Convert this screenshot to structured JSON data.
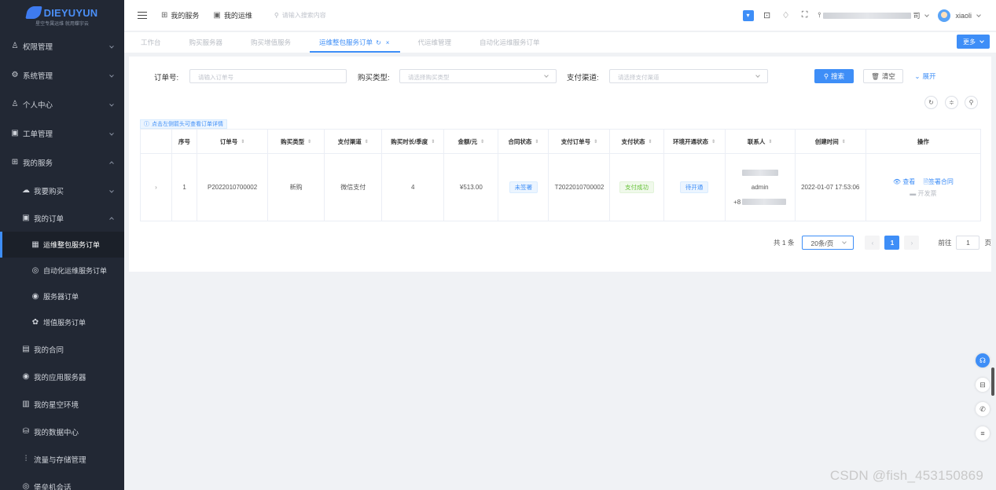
{
  "sidebar": {
    "brand": "DIEYUYUN",
    "brand_sub": "星空专属运维 就用蝶宇云",
    "items": [
      {
        "label": "权限管理",
        "level": 1,
        "icon": "user-icon",
        "glyph": "♙",
        "expanded": false
      },
      {
        "label": "系统管理",
        "level": 1,
        "icon": "settings-icon",
        "glyph": "⚙",
        "expanded": false
      },
      {
        "label": "个人中心",
        "level": 1,
        "icon": "user-icon",
        "glyph": "♙",
        "expanded": false
      },
      {
        "label": "工单管理",
        "level": 1,
        "icon": "ticket-icon",
        "glyph": "▣",
        "expanded": false
      },
      {
        "label": "我的服务",
        "level": 1,
        "icon": "grid-icon",
        "glyph": "⊞",
        "expanded": true
      },
      {
        "label": "我要购买",
        "level": 2,
        "icon": "cloud-icon",
        "glyph": "☁",
        "expanded": false
      },
      {
        "label": "我的订单",
        "level": 2,
        "icon": "order-icon",
        "glyph": "▣",
        "expanded": true
      },
      {
        "label": "运维整包服务订单",
        "level": 3,
        "icon": "calendar-icon",
        "glyph": "▦",
        "active": true
      },
      {
        "label": "自动化运维服务订单",
        "level": 3,
        "icon": "automation-icon",
        "glyph": "◎"
      },
      {
        "label": "服务器订单",
        "level": 3,
        "icon": "server-icon",
        "glyph": "◉"
      },
      {
        "label": "增值服务订单",
        "level": 3,
        "icon": "value-icon",
        "glyph": "✿"
      },
      {
        "label": "我的合同",
        "level": 2,
        "icon": "contract-icon",
        "glyph": "▤"
      },
      {
        "label": "我的应用服务器",
        "level": 2,
        "icon": "cloud-server-icon",
        "glyph": "◉"
      },
      {
        "label": "我的星空环境",
        "level": 2,
        "icon": "environment-icon",
        "glyph": "▥"
      },
      {
        "label": "我的数据中心",
        "level": 2,
        "icon": "database-icon",
        "glyph": "⛁"
      },
      {
        "label": "流量与存储管理",
        "level": 2,
        "icon": "sliders-icon",
        "glyph": "⫶"
      },
      {
        "label": "堡垒机会话",
        "level": 2,
        "icon": "session-icon",
        "glyph": "◎"
      }
    ]
  },
  "header": {
    "links": [
      {
        "label": "我的服务",
        "icon": "grid-icon",
        "glyph": "⊞"
      },
      {
        "label": "我的运维",
        "icon": "ops-icon",
        "glyph": "▣"
      }
    ],
    "search_placeholder": "请输入搜索内容",
    "org_suffix": "司",
    "user": "xiaoli"
  },
  "tabs": [
    {
      "label": "工作台"
    },
    {
      "label": "购买服务器"
    },
    {
      "label": "购买增值服务"
    },
    {
      "label": "运维整包服务订单",
      "active": true
    },
    {
      "label": "代运维管理"
    },
    {
      "label": "自动化运维服务订单"
    }
  ],
  "more_label": "更多",
  "filters": {
    "order_no": {
      "label": "订单号:",
      "placeholder": "请输入订单号"
    },
    "buy_type": {
      "label": "购买类型:",
      "placeholder": "请选择购买类型"
    },
    "pay_channel": {
      "label": "支付渠道:",
      "placeholder": "请选择支付渠道"
    },
    "search_label": "搜索",
    "clear_label": "清空",
    "expand_label": "展开"
  },
  "hint": "点击左侧箭头可查看订单详情",
  "table": {
    "columns": [
      "",
      "序号",
      "订单号",
      "购买类型",
      "支付渠道",
      "购买时长/季度",
      "金额/元",
      "合同状态",
      "支付订单号",
      "支付状态",
      "环境开通状态",
      "联系人",
      "创建时间",
      "操作"
    ],
    "rows": [
      {
        "index": "1",
        "order_no": "P2022010700002",
        "buy_type": "新购",
        "pay_channel": "微信支付",
        "duration": "4",
        "amount": "¥513.00",
        "contract_status": "未签署",
        "pay_order_no": "T2022010700002",
        "pay_status": "支付成功",
        "env_status": "待开通",
        "contact_name": "admin",
        "contact_phone_prefix": "+8",
        "created": "2022-01-07 17:53:06",
        "actions": {
          "view": "查看",
          "sign": "签署合同",
          "invoice": "开发票"
        }
      }
    ]
  },
  "pagination": {
    "total": "共 1 条",
    "page_size": "20条/页",
    "current": "1",
    "goto_prefix": "前往",
    "goto_value": "1",
    "goto_suffix": "页"
  },
  "watermark": "CSDN @fish_453150869",
  "colors": {
    "accent": "#3e8ef7",
    "sidebar": "#222834",
    "success": "#67c23a"
  }
}
